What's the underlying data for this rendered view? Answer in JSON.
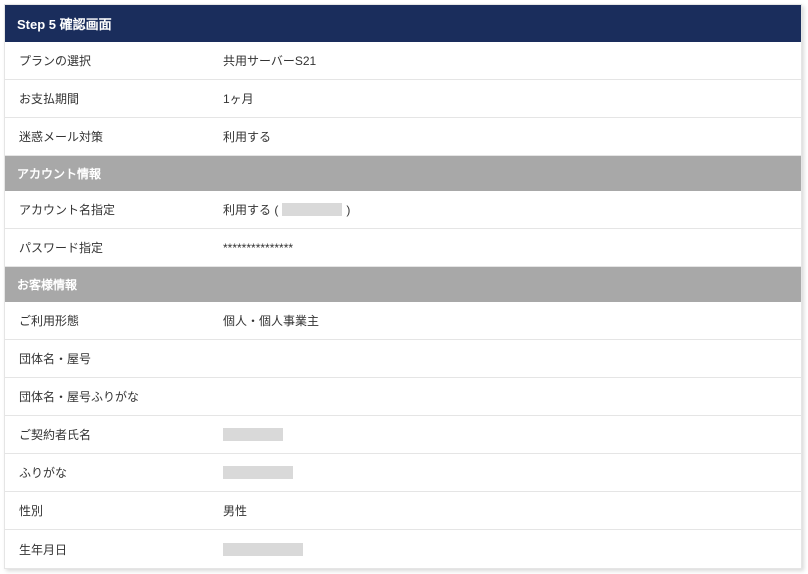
{
  "header": "Step 5 確認画面",
  "rows_top": [
    {
      "label": "プランの選択",
      "value": "共用サーバーS21"
    },
    {
      "label": "お支払期間",
      "value": "1ヶ月"
    },
    {
      "label": "迷惑メール対策",
      "value": "利用する"
    }
  ],
  "section_account": "アカウント情報",
  "account_row1_label": "アカウント名指定",
  "account_row1_prefix": "利用する (",
  "account_row1_suffix": ")",
  "account_row2_label": "パスワード指定",
  "account_row2_value": "***************",
  "section_customer": "お客様情報",
  "cust": [
    {
      "label": "ご利用形態",
      "value": "個人・個人事業主",
      "redacted": false
    },
    {
      "label": "団体名・屋号",
      "value": "",
      "redacted": false
    },
    {
      "label": "団体名・屋号ふりがな",
      "value": "",
      "redacted": false
    },
    {
      "label": "ご契約者氏名",
      "value": "",
      "redacted": true,
      "w": "w60"
    },
    {
      "label": "ふりがな",
      "value": "",
      "redacted": true,
      "w": "w70"
    },
    {
      "label": "性別",
      "value": "男性",
      "redacted": false
    },
    {
      "label": "生年月日",
      "value": "",
      "redacted": true,
      "w": "w80"
    }
  ]
}
